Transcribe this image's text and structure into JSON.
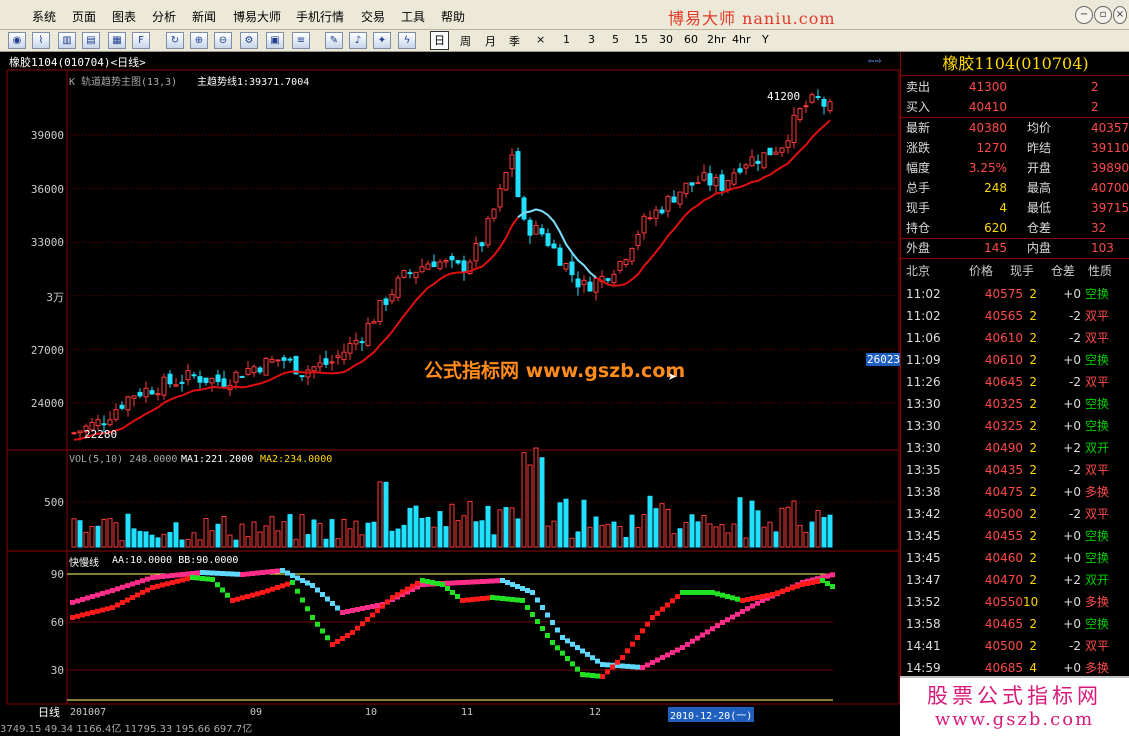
{
  "menu": {
    "items": [
      "系统",
      "页面",
      "图表",
      "分析",
      "新闻",
      "博易大师",
      "手机行情",
      "交易",
      "工具",
      "帮助"
    ],
    "brand": "博易大师 naniu.com"
  },
  "toolbar": {
    "periods": [
      "日",
      "周",
      "月",
      "季",
      "×",
      "1",
      "3",
      "5",
      "15",
      "30",
      "60",
      "2hr",
      "4hr",
      "Y"
    ],
    "active_period": "日"
  },
  "chart": {
    "window_title": "橡胶1104(010704)<日线>",
    "main_panel_title": "K 轨道趋势主图(13,3)",
    "main_indicator": "主趋势线1:39371.7004",
    "price_axis": [
      "39000",
      "36000",
      "33000",
      "3万",
      "27000",
      "24000"
    ],
    "high_label": "41200",
    "low_label": "22280",
    "current_price_tag": "26023",
    "watermark": "公式指标网  www.gszb.com",
    "vol_title": "VOL(5,10) 248.0000",
    "vol_ma1": "MA1:221.2000",
    "vol_ma2": "MA2:234.0000",
    "vol_axis": [
      "500"
    ],
    "kd_title": "快慢线",
    "kd_params": "AA:10.0000 BB:90.0000",
    "kd_axis": [
      "90",
      "60",
      "30"
    ],
    "date_labels": [
      "201007",
      "09",
      "10",
      "11",
      "12"
    ],
    "period_label": "日线",
    "cursor_date": "2010-12-20(一)",
    "chart_data": {
      "type": "candlestick",
      "title": "K 轨道趋势主图(13,3)",
      "y_axis_ticks": [
        24000,
        27000,
        30000,
        33000,
        36000,
        39000
      ],
      "ylim": [
        21500,
        42300
      ],
      "annotations": [
        {
          "label": "41200",
          "value": 41200
        },
        {
          "label": "22280",
          "value": 22280
        }
      ],
      "x_axis_labels": [
        "201007",
        "09",
        "10",
        "11",
        "12"
      ],
      "series": [
        {
          "name": "主趋势线1",
          "last_value": 39371.7004
        }
      ]
    }
  },
  "quote": {
    "title": "橡胶1104(010704)",
    "rows": [
      {
        "l1": "卖出",
        "v1": "41300",
        "l2": "",
        "v2": "2"
      },
      {
        "l1": "买入",
        "v1": "40410",
        "l2": "",
        "v2": "2"
      },
      {
        "l1": "最新",
        "v1": "40380",
        "l2": "均价",
        "v2": "40357"
      },
      {
        "l1": "涨跌",
        "v1": "1270",
        "l2": "昨结",
        "v2": "39110"
      },
      {
        "l1": "幅度",
        "v1": "3.25%",
        "l2": "开盘",
        "v2": "39890"
      },
      {
        "l1": "总手",
        "v1": "248",
        "l2": "最高",
        "v2": "40700"
      },
      {
        "l1": "现手",
        "v1": "4",
        "l2": "最低",
        "v2": "39715"
      },
      {
        "l1": "持仓",
        "v1": "620",
        "l2": "仓差",
        "v2": "32"
      },
      {
        "l1": "外盘",
        "v1": "145",
        "l2": "内盘",
        "v2": "103"
      }
    ],
    "trade_headers": [
      "北京",
      "价格",
      "现手",
      "仓差",
      "性质"
    ],
    "trades": [
      {
        "time": "11:02",
        "price": "40575",
        "vol": "2",
        "chg": "+0",
        "type": "空换"
      },
      {
        "time": "11:02",
        "price": "40565",
        "vol": "2",
        "chg": "-2",
        "type": "双平"
      },
      {
        "time": "11:06",
        "price": "40610",
        "vol": "2",
        "chg": "-2",
        "type": "双平"
      },
      {
        "time": "11:09",
        "price": "40610",
        "vol": "2",
        "chg": "+0",
        "type": "空换"
      },
      {
        "time": "11:26",
        "price": "40645",
        "vol": "2",
        "chg": "-2",
        "type": "双平"
      },
      {
        "time": "13:30",
        "price": "40325",
        "vol": "2",
        "chg": "+0",
        "type": "空换"
      },
      {
        "time": "13:30",
        "price": "40325",
        "vol": "2",
        "chg": "+0",
        "type": "空换"
      },
      {
        "time": "13:30",
        "price": "40490",
        "vol": "2",
        "chg": "+2",
        "type": "双开"
      },
      {
        "time": "13:35",
        "price": "40435",
        "vol": "2",
        "chg": "-2",
        "type": "双平"
      },
      {
        "time": "13:38",
        "price": "40475",
        "vol": "2",
        "chg": "+0",
        "type": "多换"
      },
      {
        "time": "13:42",
        "price": "40500",
        "vol": "2",
        "chg": "-2",
        "type": "双平"
      },
      {
        "time": "13:45",
        "price": "40455",
        "vol": "2",
        "chg": "+0",
        "type": "空换"
      },
      {
        "time": "13:45",
        "price": "40460",
        "vol": "2",
        "chg": "+0",
        "type": "空换"
      },
      {
        "time": "13:47",
        "price": "40470",
        "vol": "2",
        "chg": "+2",
        "type": "双开"
      },
      {
        "time": "13:52",
        "price": "40550",
        "vol": "10",
        "chg": "+0",
        "type": "多换"
      },
      {
        "time": "13:58",
        "price": "40465",
        "vol": "2",
        "chg": "+0",
        "type": "空换"
      },
      {
        "time": "14:41",
        "price": "40500",
        "vol": "2",
        "chg": "-2",
        "type": "双平"
      },
      {
        "time": "14:59",
        "price": "40685",
        "vol": "4",
        "chg": "+0",
        "type": "多换"
      }
    ]
  },
  "ad": {
    "line1": "股票公式指标网",
    "line2": "www.gszb.com"
  },
  "status": "3749.15  49.34 1166.4亿  11795.33  195.66  697.7亿"
}
